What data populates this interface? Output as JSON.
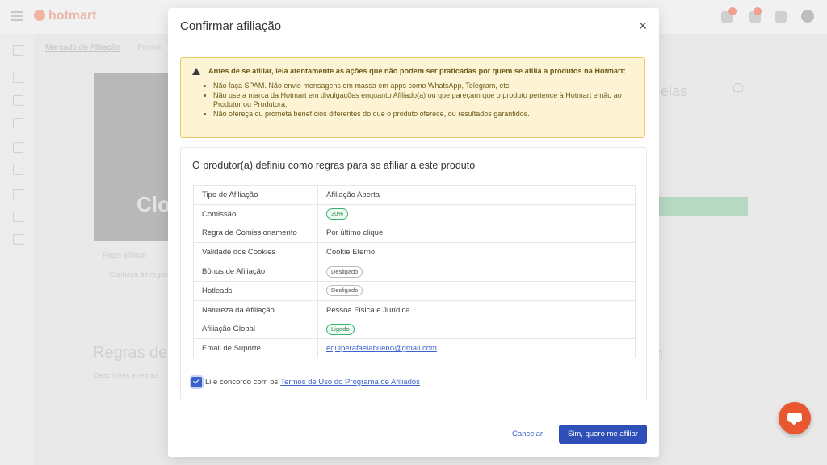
{
  "background": {
    "logo_text": "hotmart",
    "breadcrumb": "Mercado de Afiliação",
    "breadcrumb_2": "Produt",
    "cover_text": "Clo",
    "section_title": "Regras de",
    "elas_text": "elas",
    "m_text": "m",
    "notification_count": "",
    "small_text_1": "Papel afiliado",
    "small_text_2": "Conheça as regras",
    "small_text_3": "Descrições e regras"
  },
  "modal": {
    "title": "Confirmar afiliação",
    "close_label": "×",
    "warning": {
      "heading": "Antes de se afiliar, leia atentamente as ações que não podem ser praticadas por quem se afilia a produtos na Hotmart:",
      "items": [
        "Não faça SPAM. Não envie mensagens em massa em apps como WhatsApp, Telegram, etc;",
        "Não use a marca da Hotmart em divulgações enquanto Afiliado(a) ou que pareçam que o produto pertence à Hotmart e não ao Produtor ou Produtora;",
        "Não ofereça ou prometa benefícios diferentes do que o produto oferece, ou resultados garantidos."
      ]
    },
    "rules": {
      "title": "O produtor(a) definiu como regras para se afiliar a este produto",
      "rows": [
        {
          "label": "Tipo de Afiliação",
          "value": "Afiliação Aberta"
        },
        {
          "label": "Comissão",
          "value": "30%"
        },
        {
          "label": "Regra de Comissionamento",
          "value": "Por último clique"
        },
        {
          "label": "Validade dos Cookies",
          "value": "Cookie Eterno"
        },
        {
          "label": "Bônus de Afiliação",
          "value": "Desligado"
        },
        {
          "label": "Hotleads",
          "value": "Desligado"
        },
        {
          "label": "Natureza da Afiliação",
          "value": "Pessoa Física e Jurídica"
        },
        {
          "label": "Afiliação Global",
          "value": "Ligado"
        },
        {
          "label": "Email de Suporte",
          "value": "equiperafaelabueno@gmail.com"
        }
      ]
    },
    "agree_text": "Li e concordo com os",
    "terms_link": "Termos de Uso do Programa de Afiliados",
    "agree_checked": true,
    "cancel_label": "Cancelar",
    "confirm_label": "Sim, quero me afiliar"
  },
  "colors": {
    "primary": "#2f4fb8",
    "warning_bg": "#fdf4d6",
    "warning_border": "#e9c868",
    "success": "#37b26c",
    "chat_button": "#e8572f"
  }
}
